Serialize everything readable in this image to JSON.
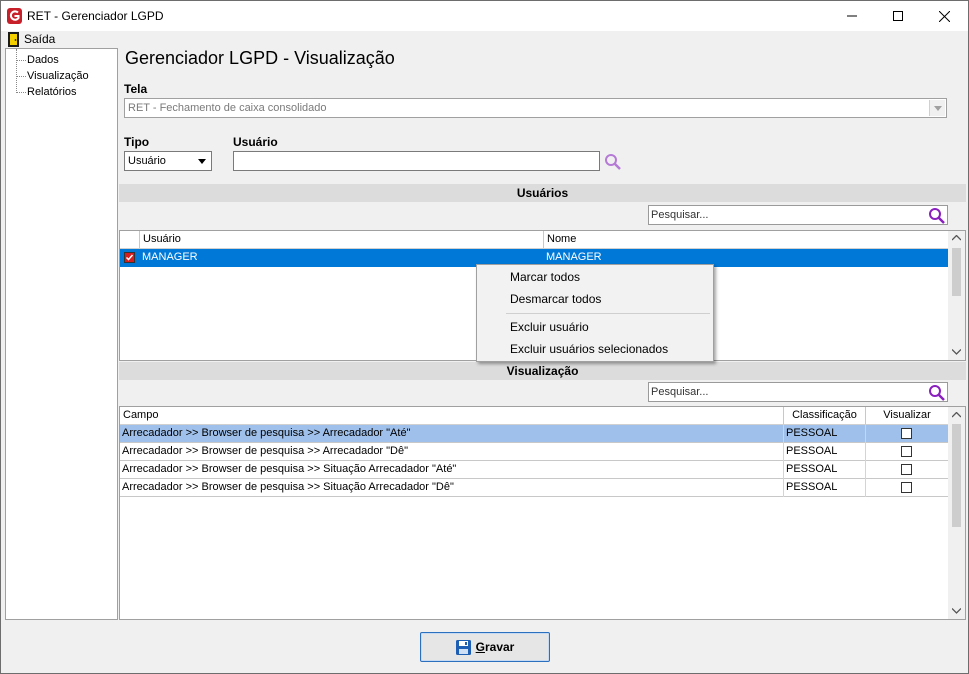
{
  "window": {
    "title": "RET - Gerenciador LGPD",
    "icon": "app-g-icon"
  },
  "menubar": {
    "exit_label": "Saída",
    "exit_underline_char": "S"
  },
  "tree": {
    "items": [
      {
        "label": "Dados"
      },
      {
        "label": "Visualização"
      },
      {
        "label": "Relatórios"
      }
    ]
  },
  "main": {
    "title": "Gerenciador LGPD - Visualização",
    "tela_label": "Tela",
    "tela_value": "RET - Fechamento de caixa consolidado",
    "tipo_label": "Tipo",
    "tipo_value": "Usuário",
    "usuario_label": "Usuário",
    "usuario_value": ""
  },
  "users_section": {
    "title": "Usuários",
    "search_placeholder": "Pesquisar...",
    "columns": [
      "Usuário",
      "Nome"
    ],
    "rows": [
      {
        "usuario": "MANAGER",
        "nome": "MANAGER",
        "checked": true,
        "selected": true
      }
    ]
  },
  "context_menu": {
    "items": [
      {
        "label": "Marcar todos"
      },
      {
        "label": "Desmarcar todos"
      },
      {
        "label": "Excluir usuário"
      },
      {
        "label": "Excluir usuários selecionados"
      }
    ]
  },
  "view_section": {
    "title": "Visualização",
    "search_placeholder": "Pesquisar...",
    "columns": [
      "Campo",
      "Classificação",
      "Visualizar"
    ],
    "rows": [
      {
        "campo": "Arrecadador >> Browser de pesquisa >> Arrecadador \"Até\"",
        "classificacao": "PESSOAL",
        "visualizar": false,
        "selected": true
      },
      {
        "campo": "Arrecadador >> Browser de pesquisa >> Arrecadador \"Dê\"",
        "classificacao": "PESSOAL",
        "visualizar": false,
        "selected": false
      },
      {
        "campo": "Arrecadador >> Browser de pesquisa >> Situação Arrecadador \"Até\"",
        "classificacao": "PESSOAL",
        "visualizar": false,
        "selected": false
      },
      {
        "campo": "Arrecadador >> Browser de pesquisa >> Situação Arrecadador \"Dê\"",
        "classificacao": "PESSOAL",
        "visualizar": false,
        "selected": false
      }
    ]
  },
  "footer": {
    "save_label": "Gravar",
    "save_icon": "floppy-disk-icon"
  },
  "colors": {
    "selection": "#0078d7",
    "row_highlight": "#9fc0ea",
    "search_icon": "#8a1fbf",
    "checkbox_red": "#d61c1c"
  }
}
